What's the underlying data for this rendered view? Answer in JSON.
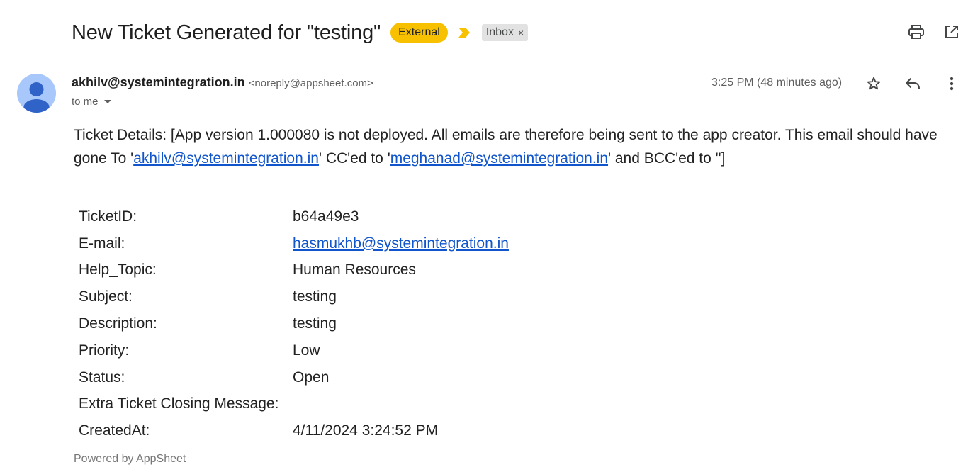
{
  "header": {
    "subject": "New Ticket Generated for \"testing\"",
    "external_label": "External",
    "inbox_label": "Inbox",
    "inbox_remove": "×",
    "icons": [
      "print-icon",
      "open-in-new-window-icon"
    ],
    "colors": {
      "external_badge": "#f8c100",
      "important_marker": "#f8c100"
    }
  },
  "message": {
    "sender_name": "akhilv@systemintegration.in",
    "sender_email": "<noreply@appsheet.com>",
    "recipient": "to me",
    "time": "3:25 PM (48 minutes ago)",
    "icons": [
      "star-icon",
      "reply-icon",
      "more-vert-icon"
    ]
  },
  "body": {
    "intro_part1": "Ticket Details: [App version 1.000080 is not deployed. All emails are therefore being sent to the app creator. This email should have gone To '",
    "to_link": "akhilv@systemintegration.in",
    "intro_part2": "' CC'ed to '",
    "cc_link": "meghanad@systemintegration.in",
    "intro_part3": "' and BCC'ed to '']"
  },
  "details": [
    {
      "label": "TicketID:",
      "value": "b64a49e3",
      "link": false
    },
    {
      "label": "E-mail:",
      "value": "hasmukhb@systemintegration.in",
      "link": true
    },
    {
      "label": "Help_Topic:",
      "value": "Human Resources",
      "link": false
    },
    {
      "label": "Subject:",
      "value": "testing",
      "link": false
    },
    {
      "label": "Description:",
      "value": "testing",
      "link": false
    },
    {
      "label": "Priority:",
      "value": "Low",
      "link": false
    },
    {
      "label": "Status:",
      "value": "Open",
      "link": false
    },
    {
      "label": "Extra Ticket Closing Message:",
      "value": "",
      "link": false
    },
    {
      "label": "CreatedAt:",
      "value": "4/11/2024 3:24:52 PM",
      "link": false
    }
  ],
  "footer": {
    "powered_by": "Powered by AppSheet"
  }
}
